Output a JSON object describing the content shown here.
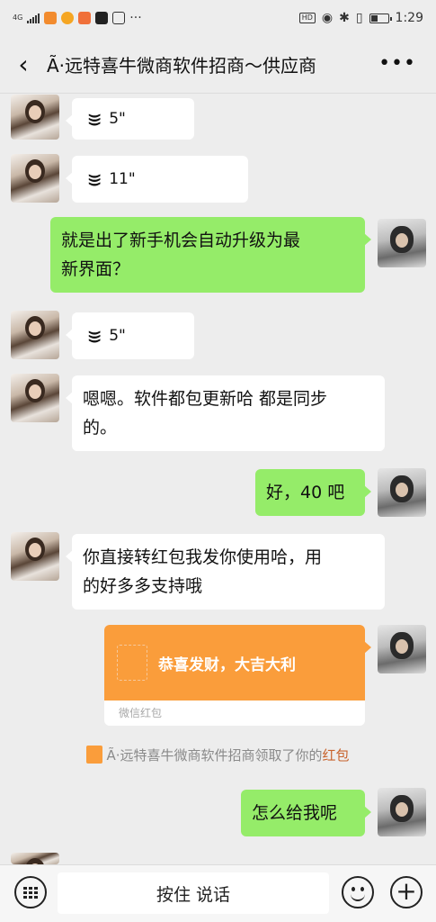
{
  "status_bar": {
    "network": "4G",
    "time": "1:29",
    "hd": "HD"
  },
  "header": {
    "back_icon": "chevron-left-icon",
    "title": "Ã·远特喜牛微商软件招商～供应商",
    "more_icon": "more-dots-icon"
  },
  "messages": [
    {
      "from": "her",
      "type": "voice",
      "duration": "5\""
    },
    {
      "from": "her",
      "type": "voice",
      "duration": "11\""
    },
    {
      "from": "me",
      "type": "text",
      "line1": "就是出了新手机会自动升级为最",
      "line2": "新界面？"
    },
    {
      "from": "her",
      "type": "voice",
      "duration": "5\""
    },
    {
      "from": "her",
      "type": "text",
      "line1": "嗯嗯。软件都包更新哈 都是同步",
      "line2": "的。"
    },
    {
      "from": "me",
      "type": "text",
      "line1": "好，40 吧"
    },
    {
      "from": "her",
      "type": "text",
      "line1": "你直接转红包我发你使用哈，用",
      "line2": "的好多多支持哦"
    },
    {
      "from": "me",
      "type": "red_packet",
      "greeting": "恭喜发财，大吉大利",
      "label": "微信红包"
    },
    {
      "from": "me",
      "type": "text",
      "line1": "怎么给我呢"
    }
  ],
  "system_message": {
    "text": "Ã·远特喜牛微商软件招商领取了你的",
    "link": "红包"
  },
  "input_bar": {
    "hold_to_talk": "按住 说话",
    "keyboard_icon": "keyboard-icon",
    "emoji_icon": "emoji-icon",
    "plus_icon": "plus-icon"
  },
  "colors": {
    "background": "#ededed",
    "my_bubble": "#95ec69",
    "their_bubble": "#ffffff",
    "red_packet": "#fa9d3b",
    "link": "#c8632d"
  }
}
